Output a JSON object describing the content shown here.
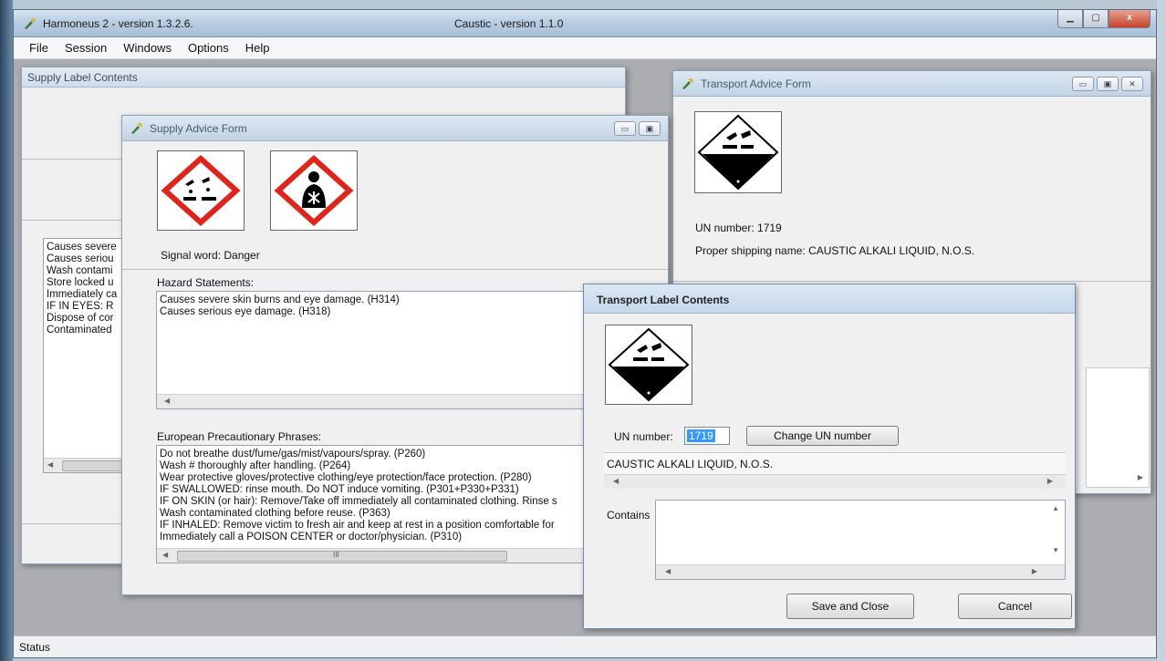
{
  "app": {
    "title": "Harmoneus 2 - version 1.3.2.6.",
    "subtitle": "Caustic - version 1.1.0",
    "controls": {
      "minimize": "▁",
      "maximize": "▢",
      "close": "x"
    }
  },
  "menu": {
    "items": [
      "File",
      "Session",
      "Windows",
      "Options",
      "Help"
    ]
  },
  "status": {
    "text": "Status"
  },
  "supply_label": {
    "title": "Supply Label Contents",
    "lines": [
      "Causes severe",
      "Causes seriou",
      "Wash contami",
      "Store locked u",
      "Immediately ca",
      "IF IN EYES: R",
      "Dispose of cor",
      "Contaminated"
    ]
  },
  "supply_advice": {
    "title": "Supply Advice Form",
    "signal_word": "Signal word: Danger",
    "hazard_label": "Hazard Statements:",
    "hazard_lines": [
      "Causes severe skin burns and eye damage. (H314)",
      "Causes serious eye damage. (H318)"
    ],
    "precaution_label": "European Precautionary Phrases:",
    "precaution_lines": [
      "Do not breathe dust/fume/gas/mist/vapours/spray. (P260)",
      "Wash # thoroughly after handling. (P264)",
      "Wear protective gloves/protective clothing/eye protection/face protection. (P280)",
      "IF SWALLOWED: rinse mouth. Do NOT induce vomiting. (P301+P330+P331)",
      "IF ON SKIN (or hair): Remove/Take off immediately all contaminated clothing. Rinse s",
      "Wash contaminated clothing before reuse. (P363)",
      "IF INHALED: Remove victim to fresh air and keep at rest in a position comfortable for",
      "Immediately call a POISON CENTER or doctor/physician. (P310)"
    ],
    "scroll_marker": "III"
  },
  "transport_advice": {
    "title": "Transport Advice Form",
    "un_number": "UN number:  1719",
    "shipping_name": "Proper shipping name:  CAUSTIC ALKALI LIQUID, N.O.S."
  },
  "transport_label": {
    "title": "Transport Label Contents",
    "un_label": "UN number:",
    "un_value": "1719",
    "change_button": "Change UN number",
    "shipping_name": "CAUSTIC ALKALI LIQUID, N.O.S.",
    "contains_label": "Contains",
    "save_button": "Save and Close",
    "cancel_button": "Cancel"
  },
  "colors": {
    "ghs_red": "#e2231a",
    "selection": "#3399ff"
  }
}
